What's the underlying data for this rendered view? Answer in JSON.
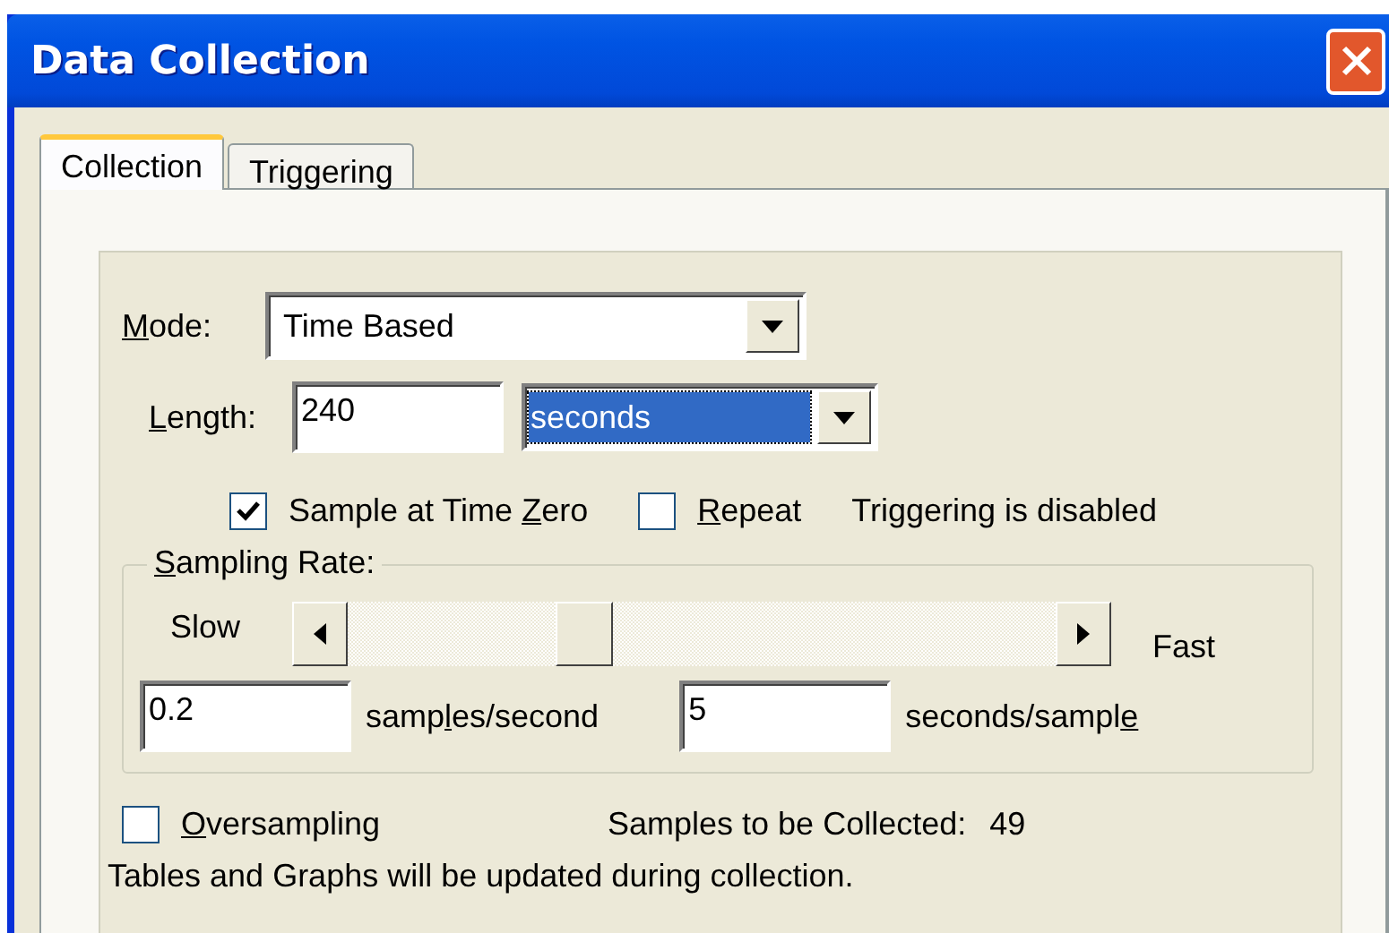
{
  "window": {
    "title": "Data Collection"
  },
  "tabs": [
    {
      "label": "Collection",
      "selected": true
    },
    {
      "label": "Triggering",
      "selected": false
    }
  ],
  "mode": {
    "label": {
      "key": "M",
      "after": "ode:"
    },
    "value": "Time Based"
  },
  "length": {
    "label": {
      "key": "L",
      "after": "ength:"
    },
    "value": "240",
    "unit": {
      "value": "seconds",
      "highlighted": true
    }
  },
  "options": [
    {
      "label": {
        "before": "Sample at Time ",
        "key": "Z",
        "after": "ero"
      },
      "checked": true
    },
    {
      "label": {
        "key": "R",
        "after": "epeat"
      },
      "checked": false
    }
  ],
  "trigger_status": "Triggering is disabled",
  "sampling_rate": {
    "title": {
      "key": "S",
      "after": "ampling Rate:"
    },
    "slow_label": "Slow",
    "fast_label": "Fast",
    "level": 0.32,
    "rate": {
      "value": "0.2",
      "unit": {
        "before": "samp",
        "key": "l",
        "after": "es/second"
      }
    },
    "period": {
      "value": "5",
      "unit": {
        "before": "seconds/sampl",
        "key": "e"
      }
    }
  },
  "oversampling": {
    "label": {
      "key": "O",
      "after": "versampling"
    },
    "checked": false
  },
  "samples_to_collect": {
    "label": "Samples to be Collected:",
    "value": "49"
  },
  "note": "Tables and Graphs will be updated during collection."
}
